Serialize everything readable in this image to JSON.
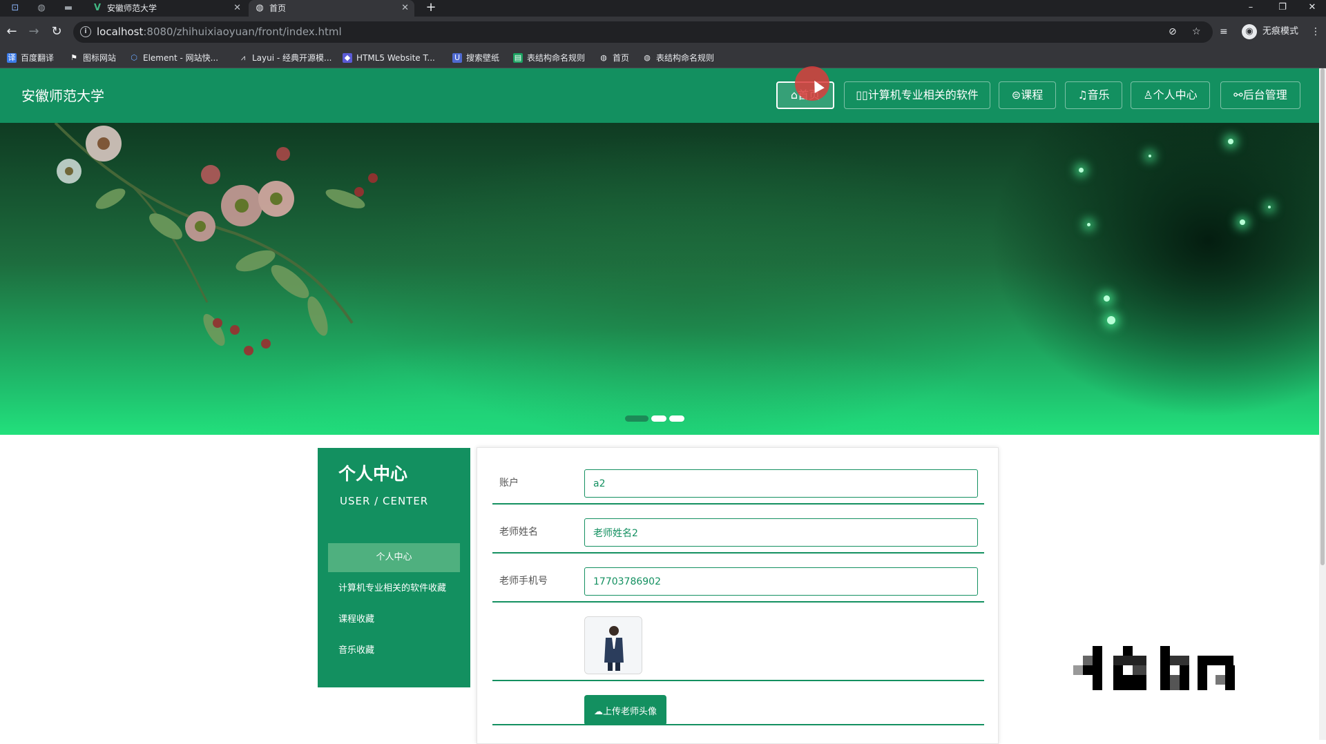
{
  "browser": {
    "tabs": [
      {
        "title": "安徽师范大学",
        "icon": "vue-logo-icon"
      },
      {
        "title": "首页",
        "icon": "globe-icon"
      }
    ],
    "url_host": "localhost",
    "url_rest": ":8080/zhihuixiaoyuan/front/index.html",
    "profile_label": "无痕模式",
    "bookmarks": [
      "百度翻译",
      "图标网站",
      "Element - 网站快...",
      "Layui - 经典开源模...",
      "HTML5 Website T...",
      "搜索壁纸",
      "表结构命名规则",
      "首页",
      "表结构命名规则"
    ]
  },
  "site": {
    "title": "安徽师范大学",
    "nav": [
      {
        "label": "首页",
        "icon": "home-icon",
        "active": true
      },
      {
        "label": "计算机专业相关的软件",
        "icon": "grid-icon"
      },
      {
        "label": "课程",
        "icon": "book-icon"
      },
      {
        "label": "音乐",
        "icon": "music-icon"
      },
      {
        "label": "个人中心",
        "icon": "user-icon"
      },
      {
        "label": "后台管理",
        "icon": "link-icon"
      }
    ]
  },
  "sidebar": {
    "title": "个人中心",
    "subtitle": "USER / CENTER",
    "items": [
      "个人中心",
      "计算机专业相关的软件收藏",
      "课程收藏",
      "音乐收藏"
    ]
  },
  "form": {
    "account_label": "账户",
    "account_value": "a2",
    "name_label": "老师姓名",
    "name_value": "老师姓名2",
    "phone_label": "老师手机号",
    "phone_value": "17703786902",
    "upload_label": "上传老师头像"
  },
  "colors": {
    "primary": "#139060",
    "sidebar_active": "#4fb07f"
  },
  "carousel": {
    "slide_count": 3,
    "active_index": 0
  }
}
